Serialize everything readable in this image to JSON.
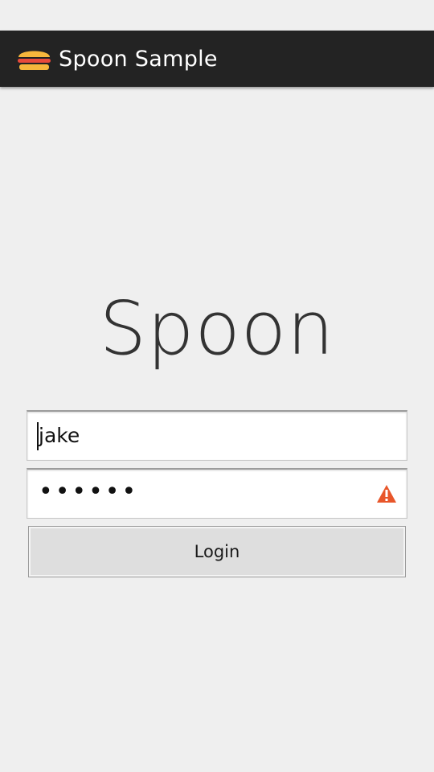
{
  "action_bar": {
    "title": "Spoon Sample",
    "icon": "burger-icon",
    "background": "#232323"
  },
  "main": {
    "logo_text": "Spoon",
    "username": {
      "value": "jake"
    },
    "password": {
      "masked_value": "••••••",
      "error_icon": "warning-icon",
      "error_color": "#e8562a"
    },
    "login_label": "Login"
  }
}
